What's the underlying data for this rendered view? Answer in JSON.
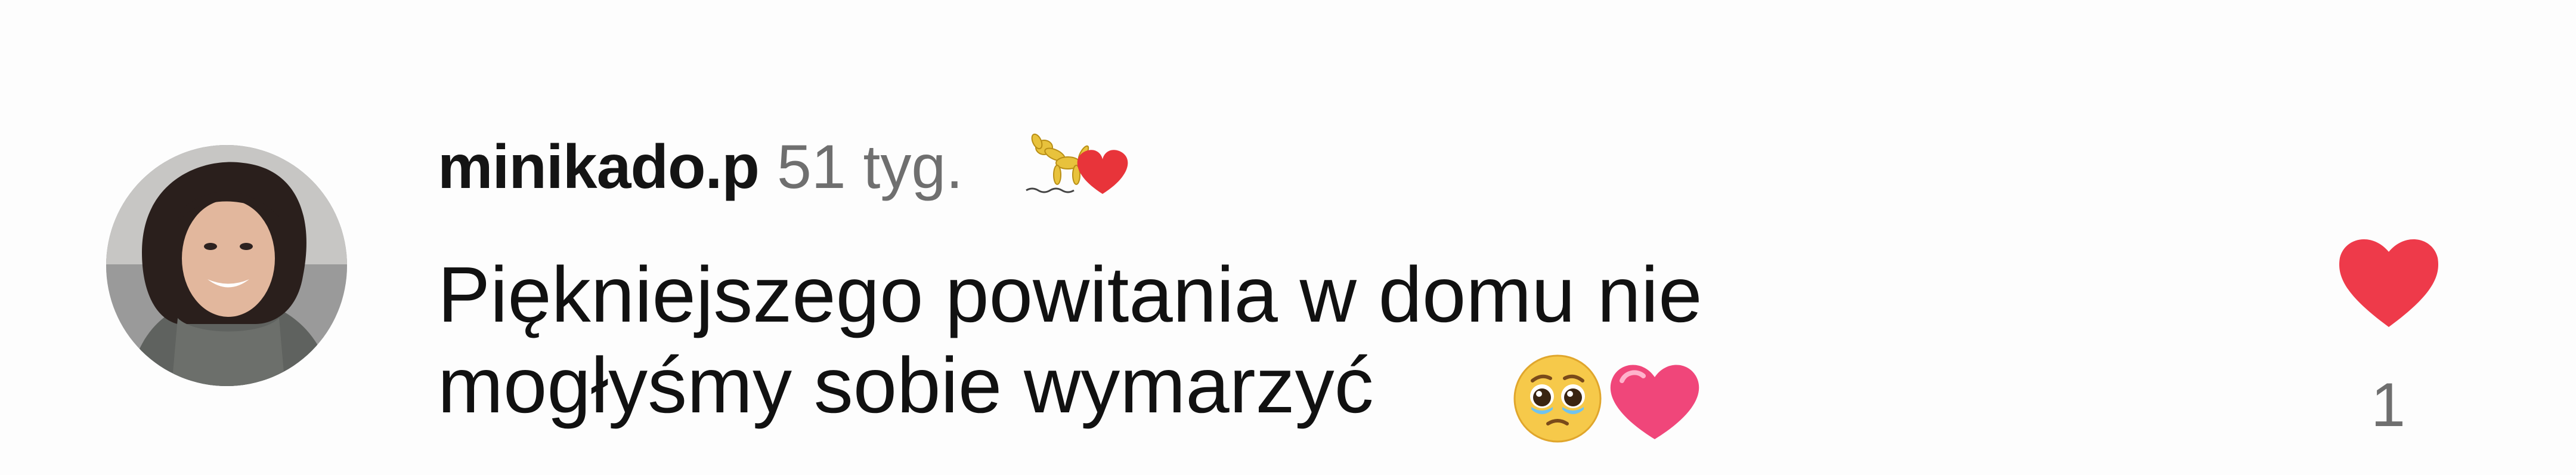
{
  "comment": {
    "username": "minikado.p",
    "time_ago": "51 tyg.",
    "text": "Piękniejszego powitania w domu nie\nmogłyśmy sobie wymarzyć",
    "text_emojis": [
      "pleading-face",
      "heart"
    ],
    "avatar": "avatar",
    "badge_icon": "balloon-dog-heart-icon"
  },
  "like": {
    "count": "1",
    "icon": "heart-icon",
    "color": "#ee3a4a"
  },
  "colors": {
    "text": "#111111",
    "secondary": "#6f6f6f",
    "background": "#fdfdfd"
  }
}
